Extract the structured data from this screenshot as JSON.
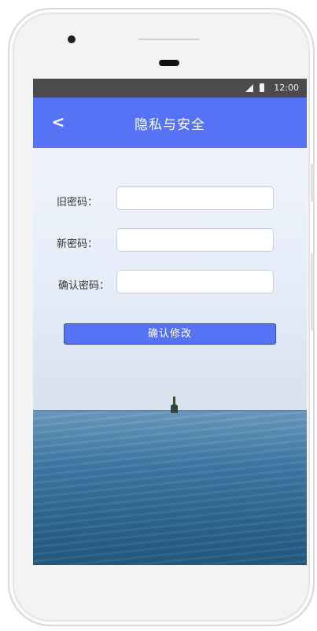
{
  "status_bar": {
    "time": "12:00",
    "icons": [
      "signal-icon",
      "battery-icon"
    ]
  },
  "header": {
    "back_icon": "<",
    "title": "隐私与安全",
    "color": "#5673f6"
  },
  "form": {
    "old_password_label": "旧密码：",
    "old_password_value": "",
    "new_password_label": "新密码：",
    "new_password_value": "",
    "confirm_password_label": "确认密码：",
    "confirm_password_value": "",
    "submit_label": "确认修改"
  }
}
